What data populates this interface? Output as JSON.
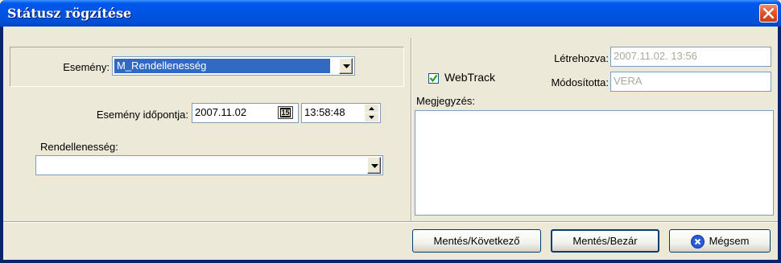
{
  "window": {
    "title": "Státusz rögzítése"
  },
  "left": {
    "event_label": "Esemény:",
    "event_value": "M_Rendellenesség",
    "event_time_label": "Esemény időpontja:",
    "date_value": "2007.11.02",
    "calendar_day": "15",
    "time_value": "13:58:48",
    "irregularity_label": "Rendellenesség:",
    "irregularity_value": ""
  },
  "right": {
    "created_label": "Létrehozva:",
    "created_value": "2007.11.02. 13:56",
    "modified_label": "Módosította:",
    "modified_value": "VERA",
    "webtrack_label": "WebTrack",
    "webtrack_checked": true,
    "note_label": "Megjegyzés:",
    "note_value": ""
  },
  "footer": {
    "save_next_label": "Mentés/Következő",
    "save_close_label": "Mentés/Bezár",
    "cancel_label": "Mégsem"
  },
  "colors": {
    "titlebar": "#0054E3",
    "face": "#ECE9D8",
    "selection": "#316AC5"
  },
  "icons": {
    "close": "close-icon",
    "dropdown": "chevron-down-icon",
    "calendar": "calendar-icon",
    "check": "check-icon",
    "cancel": "cancel-x-icon"
  }
}
